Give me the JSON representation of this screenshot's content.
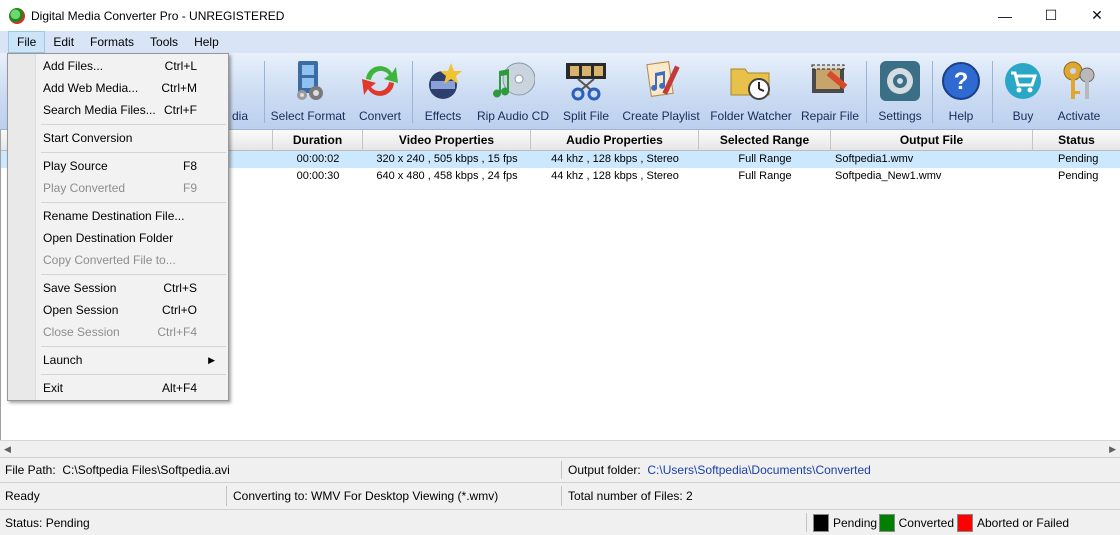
{
  "window": {
    "title": "Digital Media Converter Pro - UNREGISTERED",
    "controls": {
      "minimize": "—",
      "maximize": "☐",
      "close": "✕"
    }
  },
  "menubar": [
    "File",
    "Edit",
    "Formats",
    "Tools",
    "Help"
  ],
  "toolbar": {
    "partial_label": "dia",
    "buttons": [
      "Select Format",
      "Convert",
      "Effects",
      "Rip Audio CD",
      "Split File",
      "Create Playlist",
      "Folder Watcher",
      "Repair File",
      "Settings",
      "Help",
      "Buy",
      "Activate"
    ]
  },
  "file_menu": {
    "items": [
      {
        "label": "Add Files...",
        "shortcut": "Ctrl+L",
        "enabled": true
      },
      {
        "label": "Add Web Media...",
        "shortcut": "Ctrl+M",
        "enabled": true
      },
      {
        "label": "Search Media Files...",
        "shortcut": "Ctrl+F",
        "enabled": true
      },
      {
        "label": "Start Conversion",
        "shortcut": "",
        "enabled": true
      },
      {
        "label": "Play Source",
        "shortcut": "F8",
        "enabled": true
      },
      {
        "label": "Play Converted",
        "shortcut": "F9",
        "enabled": false
      },
      {
        "label": "Rename Destination File...",
        "shortcut": "",
        "enabled": true
      },
      {
        "label": "Open Destination Folder",
        "shortcut": "",
        "enabled": true
      },
      {
        "label": "Copy Converted File to...",
        "shortcut": "",
        "enabled": false
      },
      {
        "label": "Save Session",
        "shortcut": "Ctrl+S",
        "enabled": true
      },
      {
        "label": "Open Session",
        "shortcut": "Ctrl+O",
        "enabled": true
      },
      {
        "label": "Close Session",
        "shortcut": "Ctrl+F4",
        "enabled": false
      },
      {
        "label": "Launch",
        "shortcut": "",
        "enabled": true
      },
      {
        "label": "Exit",
        "shortcut": "Alt+F4",
        "enabled": true
      }
    ]
  },
  "table": {
    "columns": [
      "Duration",
      "Video Properties",
      "Audio Properties",
      "Selected Range",
      "Output File",
      "Status"
    ],
    "rows": [
      {
        "duration": "00:00:02",
        "video": "320 x 240 , 505 kbps , 15 fps",
        "audio": "44 khz , 128 kbps , Stereo",
        "range": "Full Range",
        "output": "Softpedia1.wmv",
        "status": "Pending"
      },
      {
        "duration": "00:00:30",
        "video": "640 x 480 , 458 kbps , 24 fps",
        "audio": "44 khz , 128 kbps , Stereo",
        "range": "Full Range",
        "output": "Softpedia_New1.wmv",
        "status": "Pending"
      }
    ]
  },
  "statusbar": {
    "file_path_label": "File Path:",
    "file_path_value": "C:\\Softpedia Files\\Softpedia.avi",
    "output_folder_label": "Output folder:",
    "output_folder_value": "C:\\Users\\Softpedia\\Documents\\Converted",
    "ready": "Ready",
    "converting_to": "Converting to: WMV For Desktop Viewing (*.wmv)",
    "total_files": "Total number of Files: 2",
    "status": "Status:  Pending",
    "legend": [
      {
        "label": "Pending",
        "color": "#000000"
      },
      {
        "label": "Converted",
        "color": "#008000"
      },
      {
        "label": "Aborted or Failed",
        "color": "#ff0000"
      }
    ]
  }
}
